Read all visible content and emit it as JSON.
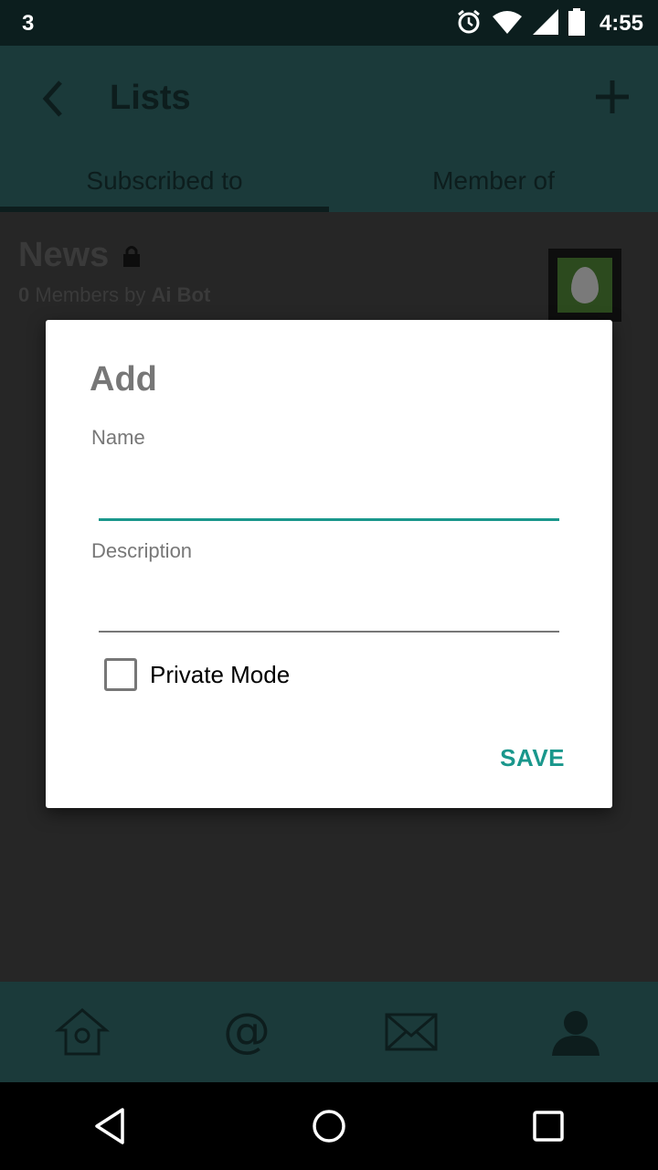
{
  "status_bar": {
    "notification_count": "3",
    "time": "4:55"
  },
  "app_bar": {
    "title": "Lists"
  },
  "tabs": [
    {
      "label": "Subscribed to",
      "active": true
    },
    {
      "label": "Member of",
      "active": false
    }
  ],
  "list_item": {
    "name": "News",
    "members_count": "0",
    "members_text": " Members by ",
    "owner": "Ai Bot"
  },
  "dialog": {
    "title": "Add",
    "name_label": "Name",
    "name_value": "",
    "description_label": "Description",
    "description_value": "",
    "private_mode_label": "Private Mode",
    "private_mode_checked": false,
    "save_label": "SAVE"
  },
  "colors": {
    "accent": "#1a978c",
    "app_bar": "#1b3a3a",
    "status_bar": "#0c1e1e"
  },
  "bottom_nav": [
    "home-icon",
    "at-icon",
    "mail-icon",
    "profile-icon"
  ],
  "system_nav": [
    "back-icon",
    "home-circle-icon",
    "recents-icon"
  ]
}
